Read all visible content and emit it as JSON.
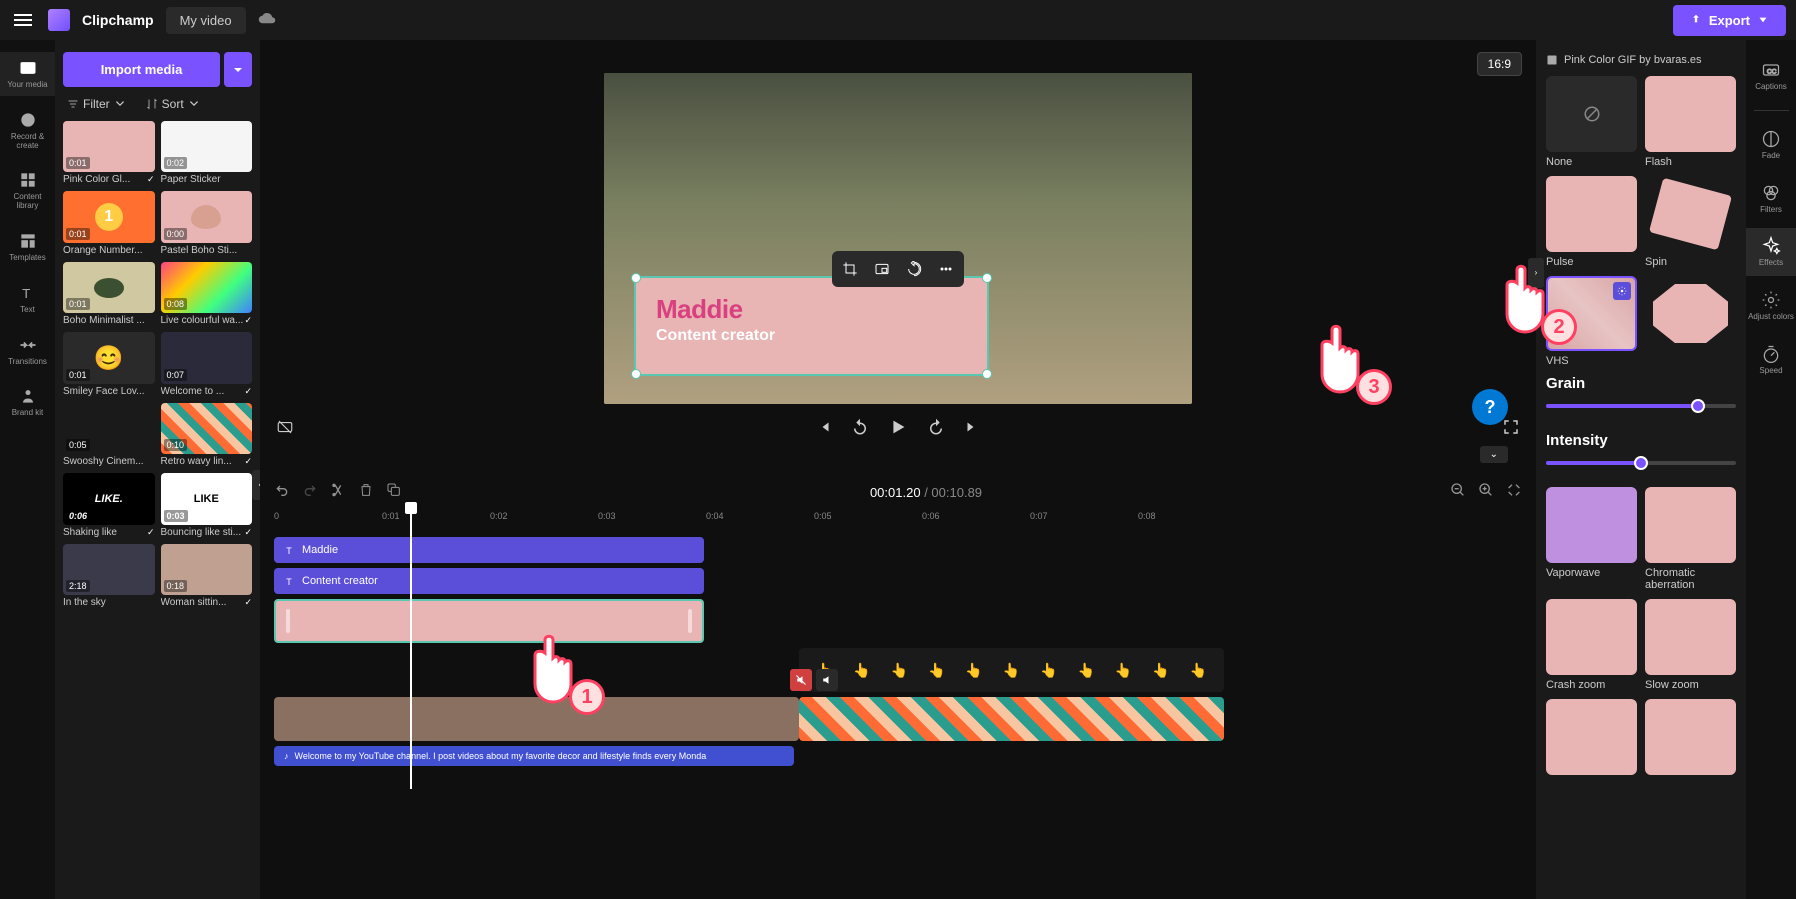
{
  "app": {
    "name": "Clipchamp",
    "project": "My video"
  },
  "export_label": "Export",
  "left_rail": [
    {
      "label": "Your media"
    },
    {
      "label": "Record & create"
    },
    {
      "label": "Content library"
    },
    {
      "label": "Templates"
    },
    {
      "label": "Text"
    },
    {
      "label": "Transitions"
    },
    {
      "label": "Brand kit"
    }
  ],
  "media_panel": {
    "import_label": "Import media",
    "filter_label": "Filter",
    "sort_label": "Sort",
    "items": [
      {
        "dur": "0:01",
        "name": "Pink Color Gl..."
      },
      {
        "dur": "0:02",
        "name": "Paper Sticker"
      },
      {
        "dur": "0:01",
        "name": "Orange Number..."
      },
      {
        "dur": "0:00",
        "name": "Pastel Boho Sti..."
      },
      {
        "dur": "0:01",
        "name": "Boho Minimalist ..."
      },
      {
        "dur": "0:08",
        "name": "Live colourful wa..."
      },
      {
        "dur": "0:01",
        "name": "Smiley Face Lov..."
      },
      {
        "dur": "0:07",
        "name": "Welcome to ..."
      },
      {
        "dur": "0:05",
        "name": "Swooshy Cinem..."
      },
      {
        "dur": "0:10",
        "name": "Retro wavy lin..."
      },
      {
        "dur": "0:06",
        "name": "Shaking like"
      },
      {
        "dur": "0:03",
        "name": "Bouncing like sti..."
      },
      {
        "dur": "2:18",
        "name": "In the sky"
      },
      {
        "dur": "0:18",
        "name": "Woman sittin..."
      }
    ]
  },
  "preview": {
    "aspect": "16:9",
    "title_name": "Maddie",
    "title_sub": "Content creator"
  },
  "playback": {
    "current": "00:01.20",
    "total": "00:10.89"
  },
  "ruler": [
    "0",
    "0:01",
    "0:02",
    "0:03",
    "0:04",
    "0:05",
    "0:06",
    "0:07",
    "0:08"
  ],
  "tracks": {
    "text1": "Maddie",
    "text2": "Content creator",
    "audio": "Welcome to my YouTube channel. I post videos about my favorite decor and lifestyle finds every Monda"
  },
  "effects_panel": {
    "title": "Pink Color GIF by bvaras.es",
    "effects": [
      {
        "label": "None"
      },
      {
        "label": "Flash"
      },
      {
        "label": "Pulse"
      },
      {
        "label": "Spin"
      },
      {
        "label": "VHS"
      },
      {
        "label": ""
      },
      {
        "label": "Vaporwave"
      },
      {
        "label": "Chromatic aberration"
      },
      {
        "label": "Crash zoom"
      },
      {
        "label": "Slow zoom"
      }
    ],
    "grain_label": "Grain",
    "intensity_label": "Intensity",
    "grain_value": 80,
    "intensity_value": 50
  },
  "right_rail": [
    {
      "label": "Captions"
    },
    {
      "label": "Fade"
    },
    {
      "label": "Filters"
    },
    {
      "label": "Effects"
    },
    {
      "label": "Adjust colors"
    },
    {
      "label": "Speed"
    }
  ],
  "callouts": {
    "c1": "1",
    "c2": "2",
    "c3": "3"
  }
}
